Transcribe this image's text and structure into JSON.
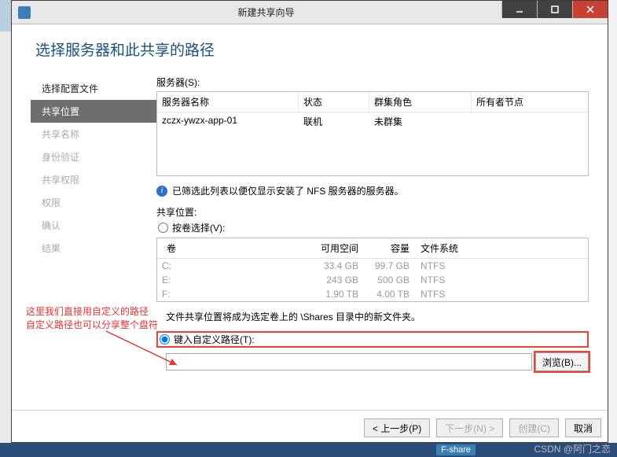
{
  "window": {
    "title": "新建共享向导"
  },
  "heading": "选择服务器和此共享的路径",
  "sidebar": {
    "items": [
      {
        "label": "选择配置文件",
        "state": "enabled"
      },
      {
        "label": "共享位置",
        "state": "active"
      },
      {
        "label": "共享名称",
        "state": "disabled"
      },
      {
        "label": "身份验证",
        "state": "disabled"
      },
      {
        "label": "共享权限",
        "state": "disabled"
      },
      {
        "label": "权限",
        "state": "disabled"
      },
      {
        "label": "确认",
        "state": "disabled"
      },
      {
        "label": "结果",
        "state": "disabled"
      }
    ]
  },
  "server": {
    "label": "服务器(S):",
    "headers": [
      "服务器名称",
      "状态",
      "群集角色",
      "所有者节点"
    ],
    "row": {
      "name": "zczx-ywzx-app-01",
      "status": "联机",
      "role": "未群集",
      "owner": ""
    }
  },
  "info_text": "已筛选此列表以便仅显示安装了 NFS 服务器的服务器。",
  "share_location_label": "共享位置:",
  "by_volume": {
    "label": "按卷选择(V):",
    "headers": [
      "卷",
      "可用空间",
      "容量",
      "文件系统"
    ],
    "rows": [
      {
        "vol": "C:",
        "free": "33.4 GB",
        "cap": "99.7 GB",
        "fs": "NTFS"
      },
      {
        "vol": "E:",
        "free": "243 GB",
        "cap": "500 GB",
        "fs": "NTFS"
      },
      {
        "vol": "F:",
        "free": "1.90 TB",
        "cap": "4.00 TB",
        "fs": "NTFS"
      }
    ],
    "note": "文件共享位置将成为选定卷上的 \\Shares 目录中的新文件夹。"
  },
  "custom_path": {
    "label": "键入自定义路径(T):",
    "value": "",
    "browse": "浏览(B)..."
  },
  "footer": {
    "prev": "< 上一步(P)",
    "next": "下一步(N) >",
    "create": "创建(C)",
    "cancel": "取消"
  },
  "annotation": {
    "line1": "这里我们直接用自定义的路径",
    "line2": "自定义路径也可以分享整个盘符"
  },
  "watermark": "CSDN @阿门之恋",
  "bottom_tag": "F-share"
}
